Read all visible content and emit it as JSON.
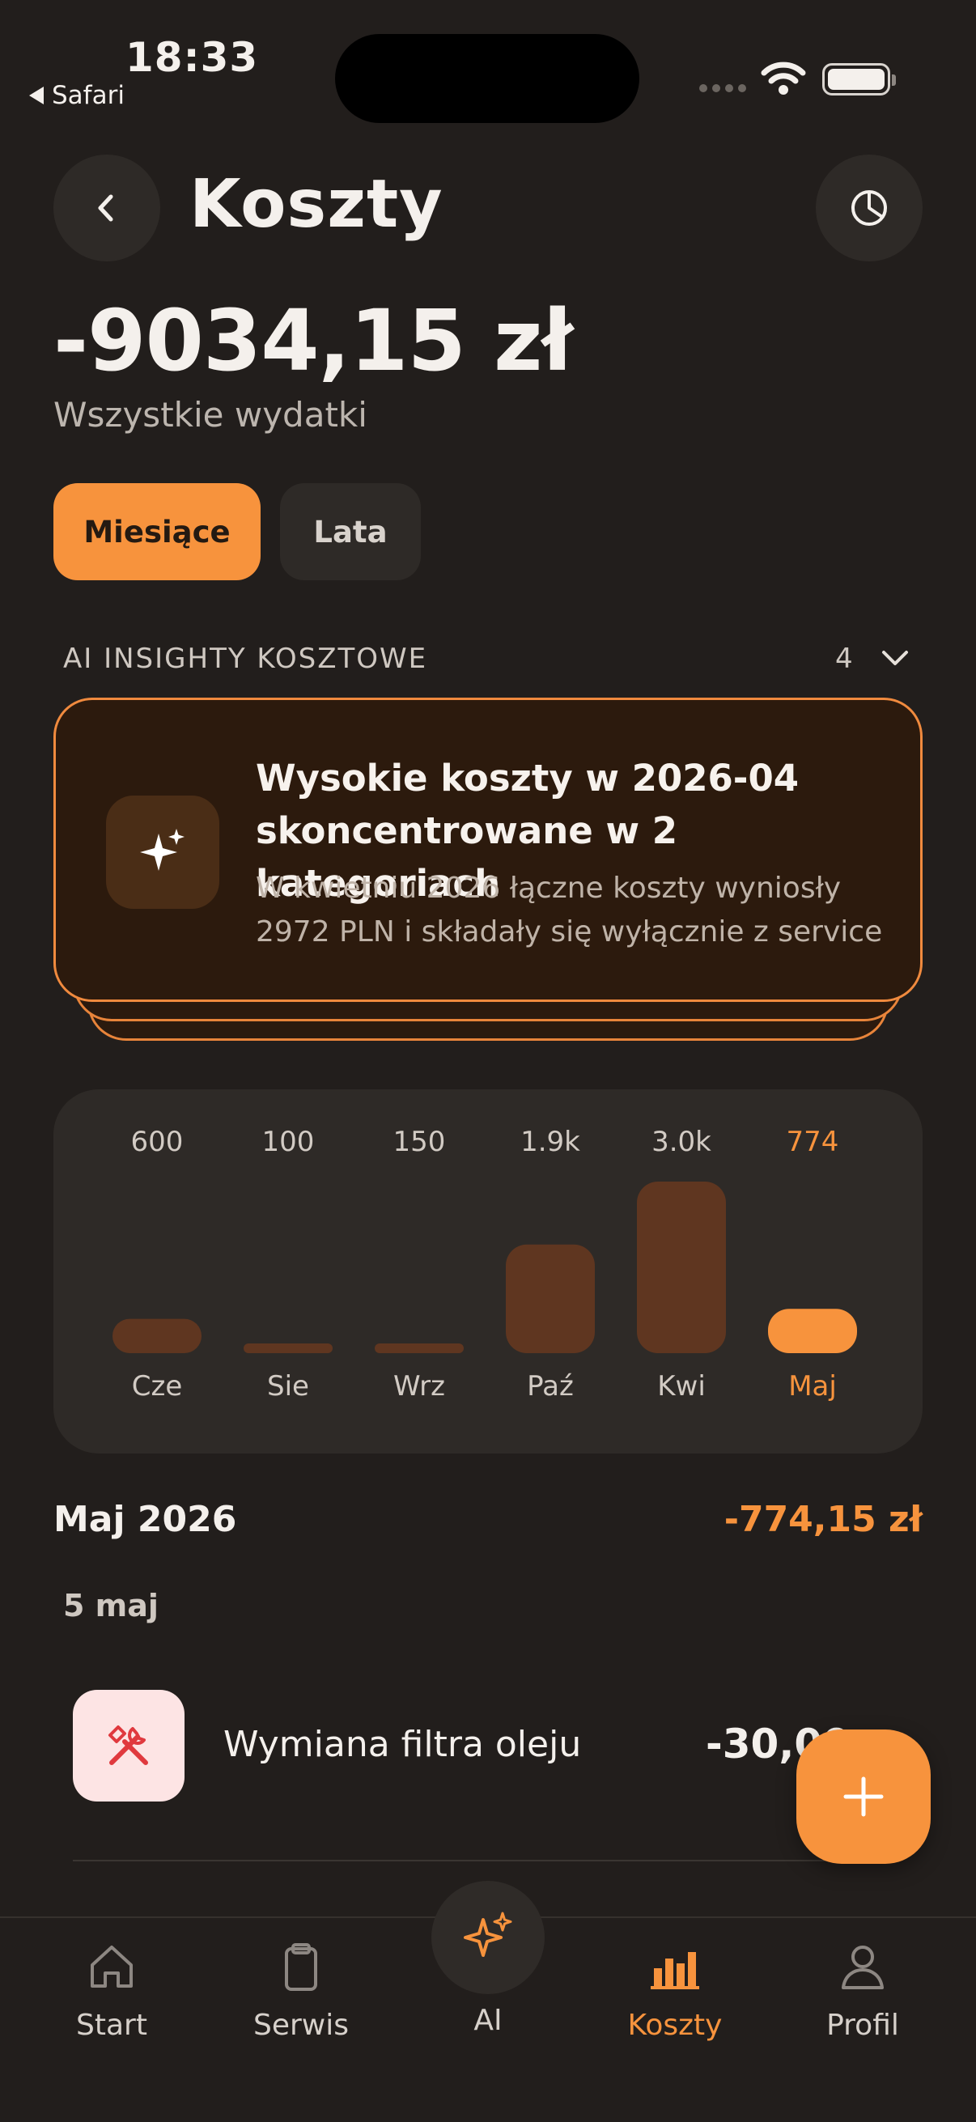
{
  "status": {
    "time": "18:33",
    "back_app": "Safari"
  },
  "header": {
    "title": "Koszty"
  },
  "summary": {
    "total": "-9034,15 zł",
    "subtitle": "Wszystkie wydatki"
  },
  "segments": [
    {
      "label": "Miesiące",
      "active": true
    },
    {
      "label": "Lata",
      "active": false
    }
  ],
  "insights": {
    "section_label": "AI INSIGHTY KOSZTOWE",
    "count": "4",
    "card": {
      "title": "Wysokie koszty w 2026-04 skoncentrowane w 2 kategoriach",
      "description": "W kwietniu 2026 łączne koszty wyniosły 2972 PLN i składały się wyłącznie z service (..."
    }
  },
  "chart_data": {
    "type": "bar",
    "categories": [
      "Cze",
      "Sie",
      "Wrz",
      "Paź",
      "Kwi",
      "Maj"
    ],
    "values": [
      600,
      100,
      150,
      1900,
      3000,
      774
    ],
    "value_labels": [
      "600",
      "100",
      "150",
      "1.9k",
      "3.0k",
      "774"
    ],
    "selected_index": 5,
    "colors": {
      "bar": "#5f3620",
      "selected": "#f7933d",
      "label": "#d2cbc4",
      "selected_label": "#f7933d"
    }
  },
  "month": {
    "title": "Maj 2026",
    "total": "-774,15 zł"
  },
  "day": {
    "label": "5 maj"
  },
  "items": [
    {
      "name": "Wymiana filtra oleju",
      "amount": "-30,00",
      "icon": "tools-icon"
    }
  ],
  "fab": {
    "icon": "plus-icon"
  },
  "tabs": [
    {
      "label": "Start",
      "icon": "home-icon",
      "active": false
    },
    {
      "label": "Serwis",
      "icon": "clipboard-icon",
      "active": false
    },
    {
      "label": "AI",
      "icon": "sparkles-icon",
      "active": false
    },
    {
      "label": "Koszty",
      "icon": "bar-chart-icon",
      "active": true
    },
    {
      "label": "Profil",
      "icon": "user-icon",
      "active": false
    }
  ],
  "colors": {
    "accent": "#f7933d",
    "background": "#221e1c",
    "surface": "#2e2a27",
    "insight_bg": "#2c1a0d"
  }
}
